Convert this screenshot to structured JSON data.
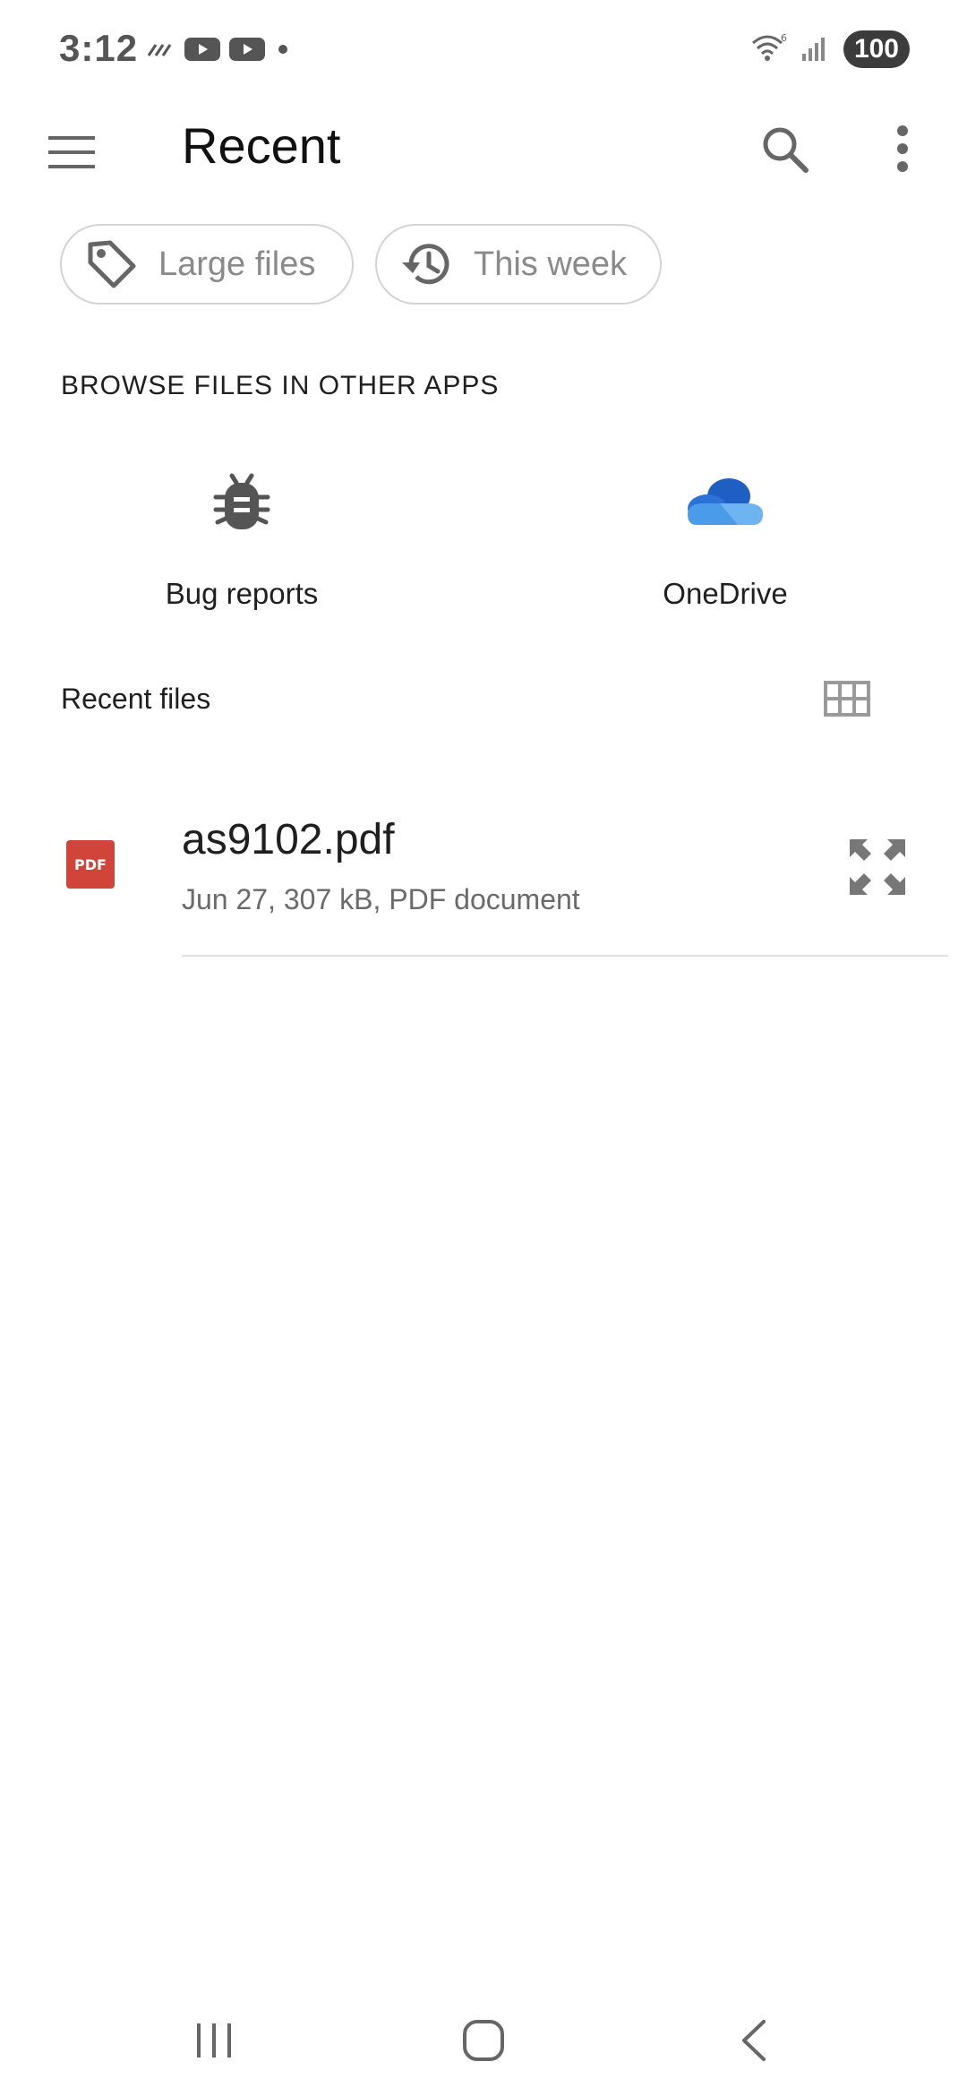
{
  "status_bar": {
    "time": "3:12",
    "battery": "100",
    "icons": [
      "data-icon",
      "youtube-icon",
      "youtube-icon",
      "dot-icon",
      "wifi-icon",
      "signal-icon"
    ]
  },
  "app_bar": {
    "title": "Recent",
    "icons": [
      "menu-icon",
      "search-icon",
      "more-vert-icon"
    ]
  },
  "chips": [
    {
      "label": "Large files",
      "icon": "tag-icon"
    },
    {
      "label": "This week",
      "icon": "history-icon"
    }
  ],
  "browse_section": {
    "heading": "BROWSE FILES IN OTHER APPS",
    "apps": [
      {
        "label": "Bug reports",
        "icon": "bug-icon"
      },
      {
        "label": "OneDrive",
        "icon": "onedrive-cloud-icon"
      }
    ]
  },
  "recent_files": {
    "heading": "Recent files",
    "view_toggle_icon": "grid-view-icon",
    "files": [
      {
        "name": "as9102.pdf",
        "meta": "Jun 27, 307 kB, PDF document",
        "type_badge": "PDF",
        "action_icon": "expand-icon"
      }
    ]
  },
  "colors": {
    "pdf_badge": "#d0443a",
    "onedrive_dark": "#1f5fc4",
    "onedrive_light": "#4a9be8",
    "chip_border": "#d4d4d4",
    "secondary_text": "#6a6a6a"
  },
  "nav_bar": {
    "icons": [
      "recents-icon",
      "home-icon",
      "back-icon"
    ]
  }
}
